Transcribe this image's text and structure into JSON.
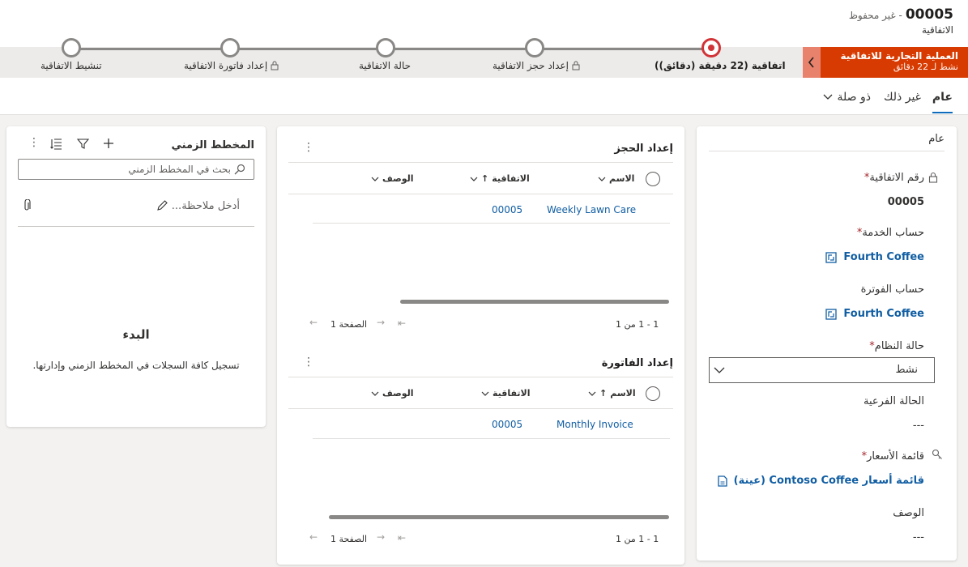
{
  "header": {
    "record_id": "00005",
    "save_state": "- غير محفوظ",
    "entity_name": "الاتفاقية"
  },
  "bpf": {
    "process_name": "العملية التجارية للاتفاقية",
    "process_status": "نشط لـ 22 دقائق",
    "stages": [
      {
        "label": "اتفاقية  (22 دقيقة (دقائق))",
        "state": "active",
        "locked": false
      },
      {
        "label": "إعداد حجز الاتفاقية",
        "state": "pending",
        "locked": true
      },
      {
        "label": "حالة الاتفاقية",
        "state": "pending",
        "locked": false
      },
      {
        "label": "إعداد فاتورة الاتفاقية",
        "state": "pending",
        "locked": true
      },
      {
        "label": "تنشيط الاتفاقية",
        "state": "pending",
        "locked": false
      }
    ]
  },
  "tabs": [
    {
      "label": "عام",
      "active": true
    },
    {
      "label": "غير ذلك",
      "active": false
    },
    {
      "label": "ذو صلة",
      "active": false
    }
  ],
  "general": {
    "section_title": "عام",
    "agreement_number_label": "رقم الاتفاقية",
    "agreement_number_value": "00005",
    "service_account_label": "حساب الخدمة",
    "service_account_value": "Fourth Coffee",
    "billing_account_label": "حساب الفوترة",
    "billing_account_value": "Fourth Coffee",
    "system_status_label": "حالة النظام",
    "system_status_value": "نشط",
    "substatus_label": "الحالة الفرعية",
    "substatus_value": "---",
    "price_list_label": "قائمة الأسعار",
    "price_list_value": "قائمة أسعار Contoso Coffee (عينة)",
    "description_label": "الوصف",
    "description_value": "---"
  },
  "booking_setup": {
    "title": "إعداد الحجز",
    "columns": [
      "الاسم",
      "الاتفاقية",
      "الوصف"
    ],
    "rows": [
      {
        "name": "Weekly Lawn Care",
        "agreement": "00005",
        "description": ""
      }
    ],
    "range": "1 - 1 من 1",
    "page": "الصفحة 1"
  },
  "invoice_setup": {
    "title": "إعداد الفاتورة",
    "columns": [
      "الاسم",
      "الاتفاقية",
      "الوصف"
    ],
    "rows": [
      {
        "name": "Monthly Invoice",
        "agreement": "00005",
        "description": ""
      }
    ],
    "range": "1 - 1 من 1",
    "page": "الصفحة 1"
  },
  "timeline": {
    "title": "المخطط الزمني",
    "search_placeholder": "بحث في المخطط الزمني",
    "note_placeholder": "أدخل ملاحظة...",
    "empty_title": "البدء",
    "empty_text": "تسجيل كافة السجلات في المخطط الزمني وإدارتها."
  },
  "colors": {
    "accent": "#0f6cbd",
    "link": "#115ea3",
    "bpf_flag": "#d83b01",
    "active_stage": "#d13438"
  }
}
